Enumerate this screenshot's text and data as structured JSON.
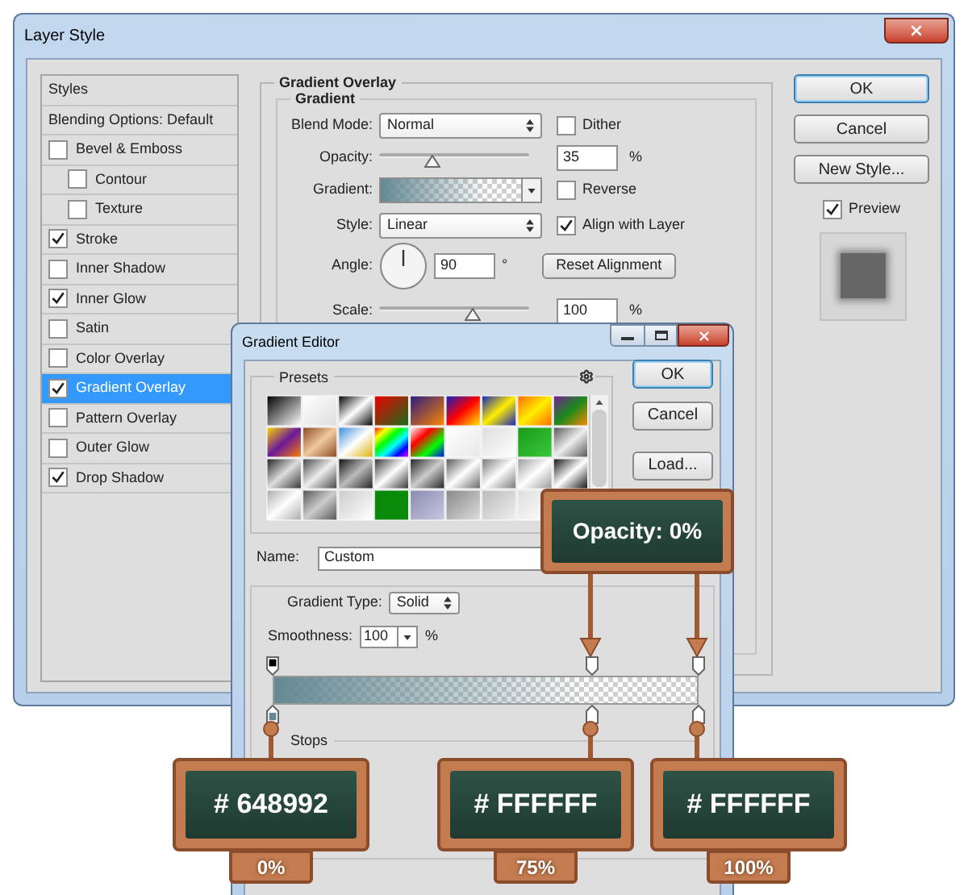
{
  "layer_style": {
    "title": "Layer Style",
    "styles": [
      {
        "label": "Styles",
        "kind": "heading",
        "selected": false
      },
      {
        "label": "Blending Options: Default",
        "kind": "heading",
        "selected": false
      },
      {
        "label": "Bevel & Emboss",
        "kind": "checkbox",
        "checked": false,
        "selected": false,
        "children": [
          {
            "label": "Contour",
            "kind": "checkbox",
            "checked": false,
            "selected": false
          },
          {
            "label": "Texture",
            "kind": "checkbox",
            "checked": false,
            "selected": false
          }
        ]
      },
      {
        "label": "Stroke",
        "kind": "checkbox",
        "checked": true,
        "selected": false
      },
      {
        "label": "Inner Shadow",
        "kind": "checkbox",
        "checked": false,
        "selected": false
      },
      {
        "label": "Inner Glow",
        "kind": "checkbox",
        "checked": true,
        "selected": false
      },
      {
        "label": "Satin",
        "kind": "checkbox",
        "checked": false,
        "selected": false
      },
      {
        "label": "Color Overlay",
        "kind": "checkbox",
        "checked": false,
        "selected": false
      },
      {
        "label": "Gradient Overlay",
        "kind": "checkbox",
        "checked": true,
        "selected": true
      },
      {
        "label": "Pattern Overlay",
        "kind": "checkbox",
        "checked": false,
        "selected": false
      },
      {
        "label": "Outer Glow",
        "kind": "checkbox",
        "checked": false,
        "selected": false
      },
      {
        "label": "Drop Shadow",
        "kind": "checkbox",
        "checked": true,
        "selected": false
      }
    ],
    "panel": {
      "title": "Gradient Overlay",
      "group": "Gradient",
      "blend_mode": {
        "label": "Blend Mode:",
        "value": "Normal"
      },
      "dither": {
        "label": "Dither",
        "checked": false
      },
      "opacity": {
        "label": "Opacity:",
        "level": 0.35,
        "value": "35",
        "unit": "%"
      },
      "gradient": {
        "label": "Gradient:"
      },
      "reverse": {
        "label": "Reverse",
        "checked": false
      },
      "style": {
        "label": "Style:",
        "value": "Linear"
      },
      "align_with_layer": {
        "label": "Align with Layer",
        "checked": true
      },
      "angle": {
        "label": "Angle:",
        "value": "90",
        "unit": "°"
      },
      "reset_alignment": "Reset Alignment",
      "scale": {
        "label": "Scale:",
        "level": 0.62,
        "value": "100",
        "unit": "%"
      }
    },
    "buttons": [
      "OK",
      "Cancel",
      "New Style..."
    ],
    "preview": {
      "label": "Preview",
      "checked": true
    }
  },
  "gradient_editor": {
    "title": "Gradient Editor",
    "presets_label": "Presets",
    "buttons": [
      "OK",
      "Cancel",
      "Load..."
    ],
    "name": {
      "label": "Name:",
      "value": "Custom"
    },
    "gradient_type": {
      "label": "Gradient Type:",
      "value": "Solid"
    },
    "smoothness": {
      "label": "Smoothness:",
      "value": "100",
      "unit": "%"
    },
    "opacity_stops": [
      {
        "level": 0,
        "opaque": true
      },
      {
        "level": 0.75,
        "opaque": false
      },
      {
        "level": 1,
        "opaque": false
      }
    ],
    "color_stops": [
      {
        "level": 0,
        "color": "#648992",
        "hex": "# 648992",
        "location": "0%"
      },
      {
        "level": 0.75,
        "color": "#ffffff",
        "hex": "# FFFFFF",
        "location": "75%"
      },
      {
        "level": 1,
        "color": "#ffffff",
        "hex": "# FFFFFF",
        "location": "100%"
      }
    ],
    "stops_label": "Stops"
  },
  "opacity_callout": "Opacity: 0%"
}
